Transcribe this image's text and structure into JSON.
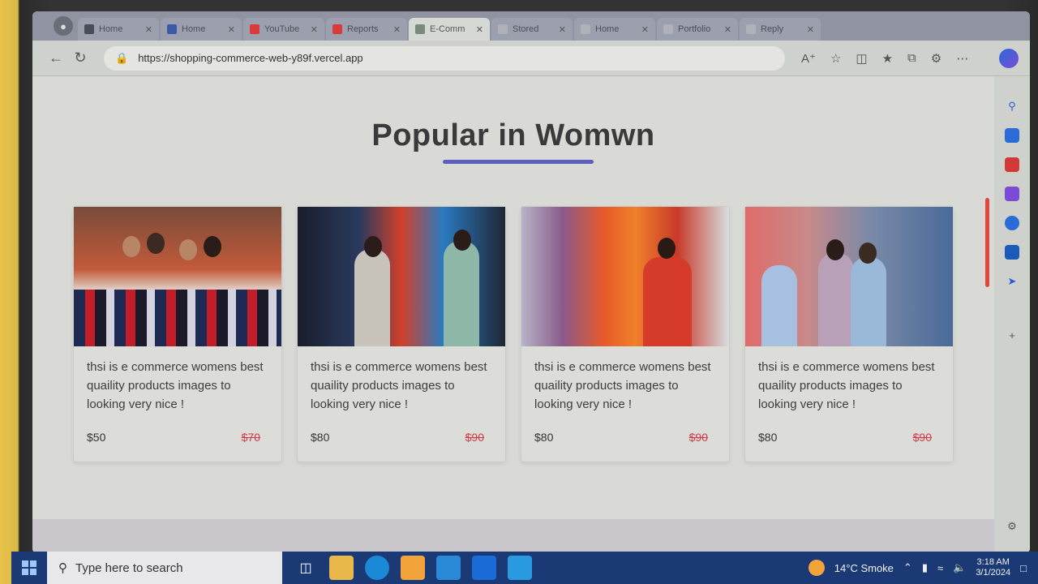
{
  "browser": {
    "tabs": [
      {
        "label": "Home",
        "color": "#4a4d58",
        "active": false
      },
      {
        "label": "Home",
        "color": "#3a5aa8",
        "active": false
      },
      {
        "label": "YouTube",
        "color": "#d93a3a",
        "active": false
      },
      {
        "label": "Reports",
        "color": "#d93a3a",
        "active": false
      },
      {
        "label": "E-Comm",
        "color": "#7a8a7a",
        "active": true
      },
      {
        "label": "Stored",
        "color": "#b0b0b8",
        "active": false
      },
      {
        "label": "Home",
        "color": "#b0b0b8",
        "active": false
      },
      {
        "label": "Portfolio",
        "color": "#b0b0b8",
        "active": false
      },
      {
        "label": "Reply",
        "color": "#b0b0b8",
        "active": false
      }
    ],
    "url": "https://shopping-commerce-web-y89f.vercel.app",
    "icons": {
      "back": "back-arrow-icon",
      "refresh": "refresh-icon",
      "lock": "lock-icon"
    }
  },
  "page": {
    "heading": "Popular in Womwn",
    "accent": "#5c5fc0",
    "products": [
      {
        "description": "thsi is e commerce womens best quaility products images to looking very nice !",
        "price": "$50",
        "old_price": "$70"
      },
      {
        "description": "thsi is e commerce womens best quaility products images to looking very nice !",
        "price": "$80",
        "old_price": "$90"
      },
      {
        "description": "thsi is e commerce womens best quaility products images to looking very nice !",
        "price": "$80",
        "old_price": "$90"
      },
      {
        "description": "thsi is e commerce womens best quaility products images to looking very nice !",
        "price": "$80",
        "old_price": "$90"
      }
    ]
  },
  "taskbar": {
    "search_placeholder": "Type here to search",
    "weather": "14°C  Smoke",
    "time": "3:18 AM",
    "date": "3/1/2024"
  }
}
